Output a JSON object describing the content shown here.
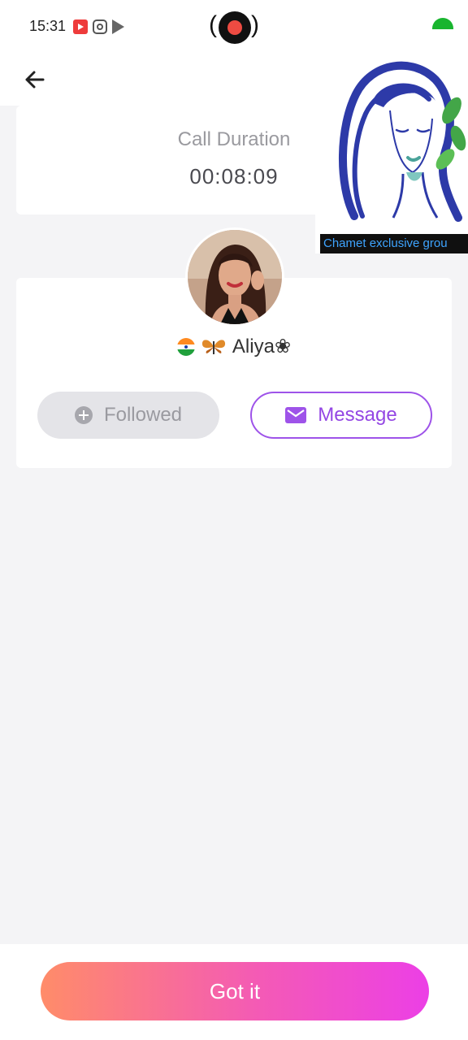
{
  "status_bar": {
    "time": "15:31"
  },
  "call": {
    "duration_label": "Call Duration",
    "duration_value": "00:08:09"
  },
  "profile": {
    "name": "Aliya❀",
    "flag": "india-flag-icon"
  },
  "buttons": {
    "followed": "Followed",
    "message": "Message",
    "got_it": "Got it"
  },
  "overlay": {
    "caption": "Chamet exclusive grou"
  },
  "colors": {
    "accent_purple": "#9e53e9",
    "gradient_start": "#ff8c69",
    "gradient_end": "#ec3fe6",
    "followed_bg": "#e4e4e8"
  }
}
